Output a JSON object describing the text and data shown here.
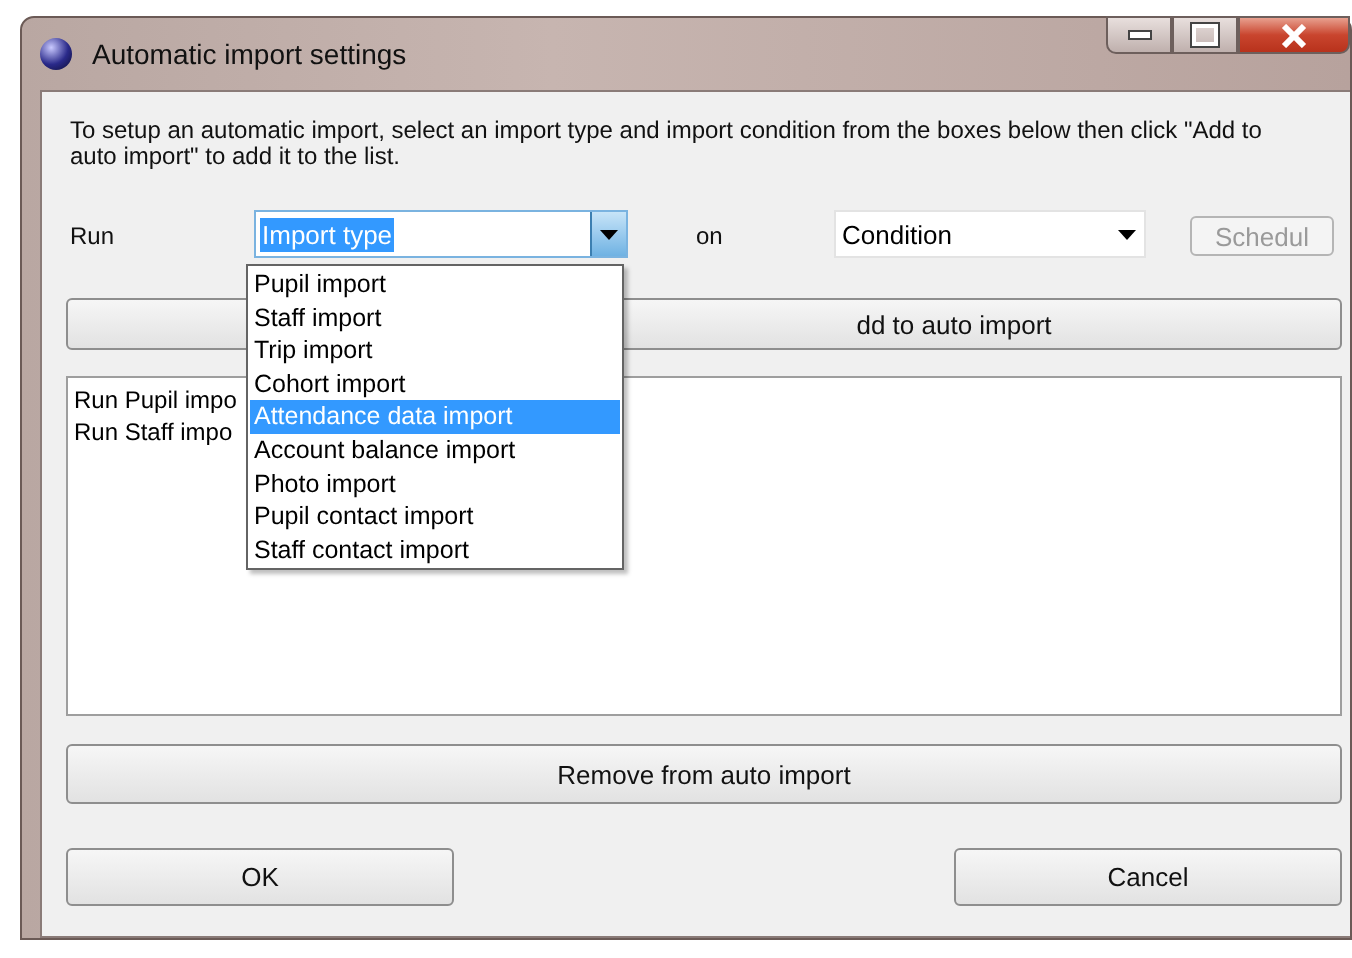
{
  "window": {
    "title": "Automatic import settings"
  },
  "intro": "To setup an automatic import, select an import type and import condition from the boxes below then click \"Add to auto import\" to add it to the list.",
  "run_label": "Run",
  "import_type": {
    "value": "Import type",
    "focused": true,
    "expanded": true,
    "options": [
      {
        "label": "Pupil import",
        "selected": false
      },
      {
        "label": "Staff import",
        "selected": false
      },
      {
        "label": "Trip import",
        "selected": false
      },
      {
        "label": "Cohort import",
        "selected": false
      },
      {
        "label": "Attendance data import",
        "selected": true
      },
      {
        "label": "Account balance import",
        "selected": false
      },
      {
        "label": "Photo import",
        "selected": false
      },
      {
        "label": "Pupil contact import",
        "selected": false
      },
      {
        "label": "Staff contact import",
        "selected": false
      }
    ]
  },
  "on_label": "on",
  "condition": {
    "value": "Condition",
    "focused": false
  },
  "schedule_button": {
    "label": "Schedul",
    "disabled": true
  },
  "add_button": {
    "label": "dd to auto import"
  },
  "auto_imports": [
    {
      "label": "Run Pupil impo"
    },
    {
      "label": "Run Staff impo"
    }
  ],
  "remove_button": {
    "label": "Remove from auto import"
  },
  "ok_button": {
    "label": "OK"
  },
  "cancel_button": {
    "label": "Cancel"
  }
}
